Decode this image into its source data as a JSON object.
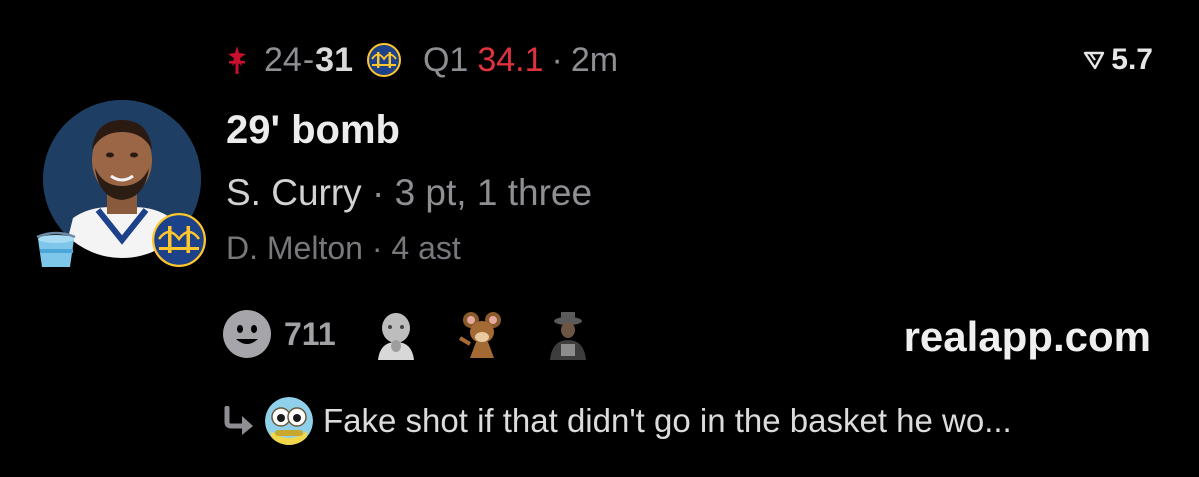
{
  "game": {
    "away_team_icon": "houston-rockets-logo",
    "away_score": "24",
    "separator": "-",
    "home_score": "31",
    "home_team_icon": "golden-state-warriors-logo",
    "period": "Q1",
    "clock": "34.1",
    "dot": "·",
    "time_ago": "2m",
    "clock_color": "#e0323c"
  },
  "rating": {
    "icon": "rating-chevron-icon",
    "value": "5.7"
  },
  "play": {
    "headline": "29' bomb",
    "scorer_name": "S. Curry",
    "scorer_dot": " · ",
    "scorer_stats": "3 pt, 1 three",
    "assist_name": "D. Melton",
    "assist_dot": " · ",
    "assist_stats": "4 ast"
  },
  "avatar": {
    "player": "player-photo",
    "badge_left": "bucket-icon",
    "badge_right": "golden-state-warriors-logo"
  },
  "reactions": {
    "icon": "smiley-icon",
    "count": "711",
    "avatars": [
      "baby-avatar",
      "cartoon-mouse-avatar",
      "hat-man-avatar"
    ]
  },
  "site": "realapp.com",
  "comment": {
    "icon": "reply-arrow-icon",
    "avatar": "bug-eyed-avatar",
    "text": "Fake shot if that didn't go in the basket he wo..."
  }
}
